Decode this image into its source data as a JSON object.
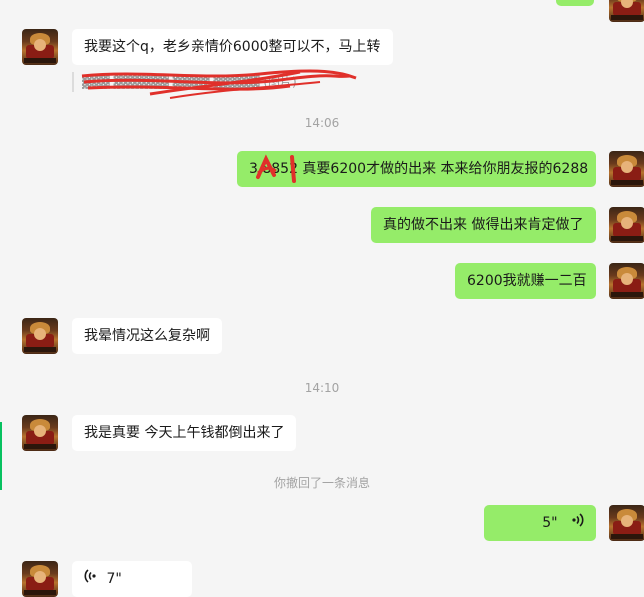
{
  "messages": [
    {
      "text": "我要这个q，老乡亲情价6000整可以不，马上转"
    },
    {
      "quote": "▓▓▓ ▓▓▓▓▓▓ ▓▓▓▓ ▓▓▓▓▓ (图片)"
    },
    {
      "time": "14:06"
    },
    {
      "text": "3  8852 真要6200才做的出来 本来给你朋友报的6288"
    },
    {
      "text": "真的做不出来 做得出来肯定做了"
    },
    {
      "text": "6200我就赚一二百"
    },
    {
      "text": "我晕情况这么复杂啊"
    },
    {
      "time": "14:10"
    },
    {
      "text": "我是真要 今天上午钱都倒出来了"
    },
    {
      "system": "你撤回了一条消息"
    },
    {
      "voice": "5\""
    },
    {
      "voice": "7\""
    }
  ],
  "colors": {
    "outgoing_bubble": "#95ec69",
    "incoming_bubble": "#ffffff",
    "background": "#f5f5f5",
    "redaction": "#e0302a"
  },
  "icons": {
    "voice_out": "voice-wave-icon",
    "voice_in": "voice-wave-icon"
  }
}
